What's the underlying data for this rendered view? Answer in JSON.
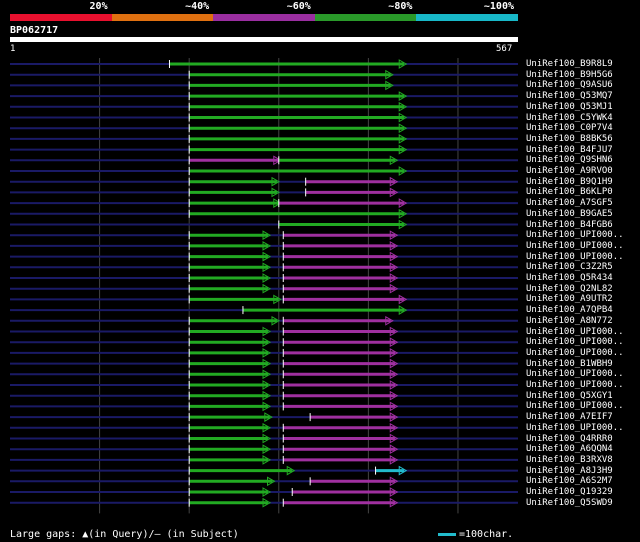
{
  "scale": {
    "labels": [
      "20%",
      "~40%",
      "~60%",
      "~80%",
      "~100%"
    ],
    "colors": [
      "#e8102e",
      "#e07010",
      "#9a2ea0",
      "#2a9a2a",
      "#18b8c8"
    ]
  },
  "query": {
    "id": "BP062717",
    "start": "1",
    "end": "567",
    "length": 567
  },
  "hit_colors": {
    "green": "#22aa22",
    "magenta": "#a030a0",
    "cyan": "#22bbcc",
    "track": "#1a1a66",
    "grid": "#444444"
  },
  "hits": [
    {
      "name": "UniRef100_B9R8L9",
      "segs": [
        [
          178,
          440,
          "green"
        ]
      ]
    },
    {
      "name": "UniRef100_B9H5G6",
      "segs": [
        [
          200,
          425,
          "green"
        ]
      ]
    },
    {
      "name": "UniRef100_Q9ASU6",
      "segs": [
        [
          200,
          425,
          "green"
        ]
      ]
    },
    {
      "name": "UniRef100_Q53MQ7",
      "segs": [
        [
          200,
          440,
          "green"
        ]
      ]
    },
    {
      "name": "UniRef100_Q53MJ1",
      "segs": [
        [
          200,
          440,
          "green"
        ]
      ]
    },
    {
      "name": "UniRef100_C5YWK4",
      "segs": [
        [
          200,
          440,
          "green"
        ]
      ]
    },
    {
      "name": "UniRef100_C0P7V4",
      "segs": [
        [
          200,
          440,
          "green"
        ]
      ]
    },
    {
      "name": "UniRef100_B8BK56",
      "segs": [
        [
          200,
          440,
          "green"
        ]
      ]
    },
    {
      "name": "UniRef100_B4FJU7",
      "segs": [
        [
          200,
          440,
          "green"
        ]
      ]
    },
    {
      "name": "UniRef100_Q9SHN6",
      "segs": [
        [
          200,
          300,
          "magenta"
        ],
        [
          300,
          430,
          "green"
        ]
      ]
    },
    {
      "name": "UniRef100_A9RVO0",
      "segs": [
        [
          200,
          440,
          "green"
        ]
      ]
    },
    {
      "name": "UniRef100_B9Q1H9",
      "segs": [
        [
          200,
          298,
          "green"
        ],
        [
          330,
          430,
          "magenta"
        ]
      ]
    },
    {
      "name": "UniRef100_B6KLP0",
      "segs": [
        [
          200,
          298,
          "green"
        ],
        [
          330,
          430,
          "magenta"
        ]
      ]
    },
    {
      "name": "UniRef100_A7SGF5",
      "segs": [
        [
          200,
          300,
          "green"
        ],
        [
          300,
          440,
          "magenta"
        ]
      ]
    },
    {
      "name": "UniRef100_B9GAE5",
      "segs": [
        [
          200,
          440,
          "green"
        ]
      ]
    },
    {
      "name": "UniRef100_B4FGB6",
      "segs": [
        [
          300,
          440,
          "green"
        ]
      ]
    },
    {
      "name": "UniRef100_UPI000..",
      "segs": [
        [
          200,
          288,
          "green"
        ],
        [
          305,
          430,
          "magenta"
        ]
      ]
    },
    {
      "name": "UniRef100_UPI000..",
      "segs": [
        [
          200,
          288,
          "green"
        ],
        [
          305,
          430,
          "magenta"
        ]
      ]
    },
    {
      "name": "UniRef100_UPI000..",
      "segs": [
        [
          200,
          288,
          "green"
        ],
        [
          305,
          430,
          "magenta"
        ]
      ]
    },
    {
      "name": "UniRef100_C3Z2R5",
      "segs": [
        [
          200,
          288,
          "green"
        ],
        [
          305,
          430,
          "magenta"
        ]
      ]
    },
    {
      "name": "UniRef100_Q5R434",
      "segs": [
        [
          200,
          288,
          "green"
        ],
        [
          305,
          430,
          "magenta"
        ]
      ]
    },
    {
      "name": "UniRef100_Q2NL82",
      "segs": [
        [
          200,
          288,
          "green"
        ],
        [
          305,
          430,
          "magenta"
        ]
      ]
    },
    {
      "name": "UniRef100_A9UTR2",
      "segs": [
        [
          200,
          300,
          "green"
        ],
        [
          305,
          440,
          "magenta"
        ]
      ]
    },
    {
      "name": "UniRef100_A7QPB4",
      "segs": [
        [
          260,
          440,
          "green"
        ]
      ]
    },
    {
      "name": "UniRef100_A8N772",
      "segs": [
        [
          200,
          298,
          "green"
        ],
        [
          305,
          425,
          "magenta"
        ]
      ]
    },
    {
      "name": "UniRef100_UPI000..",
      "segs": [
        [
          200,
          288,
          "green"
        ],
        [
          305,
          430,
          "magenta"
        ]
      ]
    },
    {
      "name": "UniRef100_UPI000..",
      "segs": [
        [
          200,
          288,
          "green"
        ],
        [
          305,
          430,
          "magenta"
        ]
      ]
    },
    {
      "name": "UniRef100_UPI000..",
      "segs": [
        [
          200,
          288,
          "green"
        ],
        [
          305,
          430,
          "magenta"
        ]
      ]
    },
    {
      "name": "UniRef100_B1WBH9",
      "segs": [
        [
          200,
          288,
          "green"
        ],
        [
          305,
          430,
          "magenta"
        ]
      ]
    },
    {
      "name": "UniRef100_UPI000..",
      "segs": [
        [
          200,
          288,
          "green"
        ],
        [
          305,
          430,
          "magenta"
        ]
      ]
    },
    {
      "name": "UniRef100_UPI000..",
      "segs": [
        [
          200,
          288,
          "green"
        ],
        [
          305,
          430,
          "magenta"
        ]
      ]
    },
    {
      "name": "UniRef100_Q5XGY1",
      "segs": [
        [
          200,
          288,
          "green"
        ],
        [
          305,
          430,
          "magenta"
        ]
      ]
    },
    {
      "name": "UniRef100_UPI000..",
      "segs": [
        [
          200,
          288,
          "green"
        ],
        [
          305,
          430,
          "magenta"
        ]
      ]
    },
    {
      "name": "UniRef100_A7EIF7",
      "segs": [
        [
          200,
          290,
          "green"
        ],
        [
          335,
          430,
          "magenta"
        ]
      ]
    },
    {
      "name": "UniRef100_UPI000..",
      "segs": [
        [
          200,
          288,
          "green"
        ],
        [
          305,
          430,
          "magenta"
        ]
      ]
    },
    {
      "name": "UniRef100_Q4RRR0",
      "segs": [
        [
          200,
          288,
          "green"
        ],
        [
          305,
          430,
          "magenta"
        ]
      ]
    },
    {
      "name": "UniRef100_A6QQN4",
      "segs": [
        [
          200,
          288,
          "green"
        ],
        [
          305,
          430,
          "magenta"
        ]
      ]
    },
    {
      "name": "UniRef100_B3RXV8",
      "segs": [
        [
          200,
          288,
          "green"
        ],
        [
          305,
          430,
          "magenta"
        ]
      ]
    },
    {
      "name": "UniRef100_A8J3H9",
      "segs": [
        [
          200,
          315,
          "green"
        ],
        [
          408,
          440,
          "cyan"
        ]
      ]
    },
    {
      "name": "UniRef100_A6S2M7",
      "segs": [
        [
          200,
          293,
          "green"
        ],
        [
          335,
          430,
          "magenta"
        ]
      ]
    },
    {
      "name": "UniRef100_Q19329",
      "segs": [
        [
          200,
          288,
          "green"
        ],
        [
          315,
          430,
          "magenta"
        ]
      ]
    },
    {
      "name": "UniRef100_Q5SWD9",
      "segs": [
        [
          200,
          288,
          "green"
        ],
        [
          305,
          430,
          "magenta"
        ]
      ]
    }
  ],
  "footer": {
    "large_gaps": "Large gaps: ▲(in Query)/– (in Subject)",
    "legend": "=100char."
  }
}
